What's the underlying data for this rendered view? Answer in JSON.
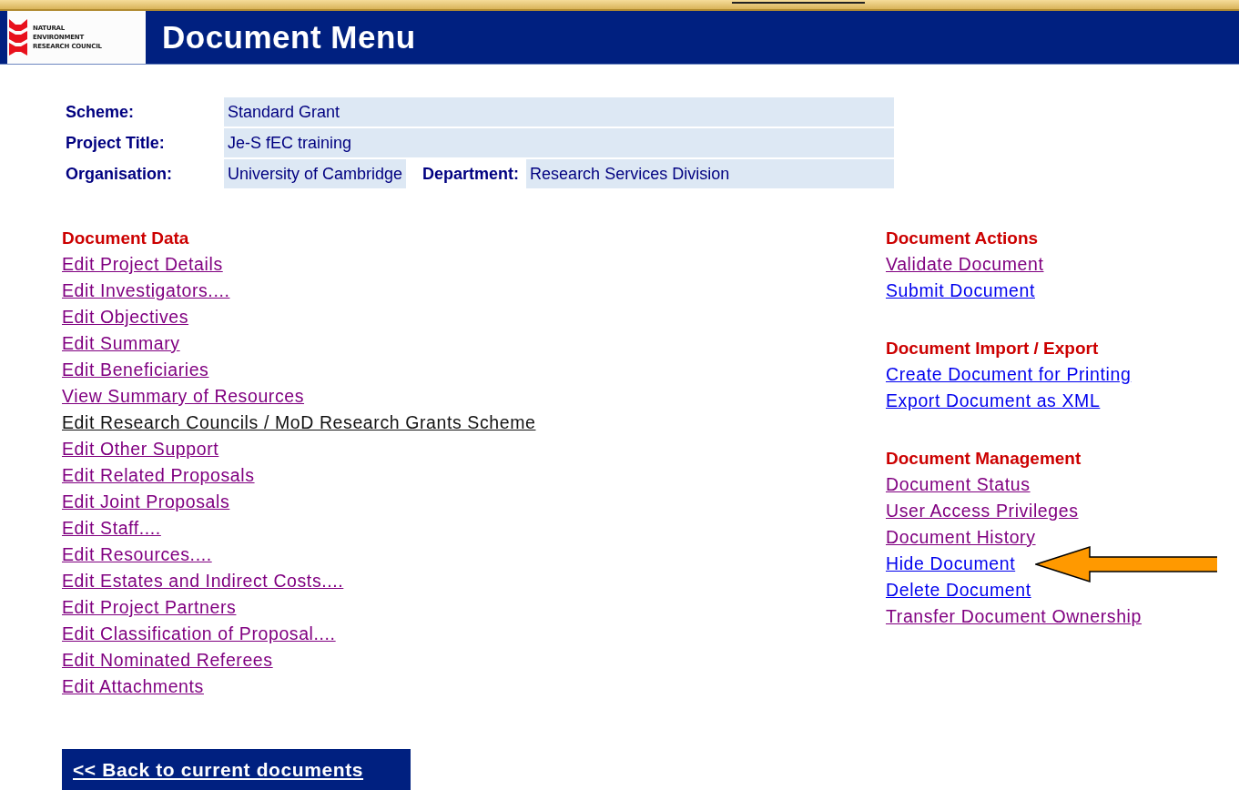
{
  "header": {
    "logo_lines": [
      "NATURAL",
      "ENVIRONMENT",
      "RESEARCH COUNCIL"
    ],
    "title": "Document Menu"
  },
  "info": [
    {
      "label": "Scheme:",
      "value": "Standard Grant"
    },
    {
      "label": "Project Title:",
      "value": "Je-S fEC training"
    },
    {
      "label": "Organisation:",
      "value": "University of Cambridge",
      "label_2": "Department:",
      "value_2": "Research Services Division"
    }
  ],
  "left_sections": [
    {
      "heading": "Document Data",
      "links": [
        {
          "label": "Edit Project Details",
          "visited": true,
          "hover": false
        },
        {
          "label": "Edit Investigators....",
          "visited": true,
          "hover": false
        },
        {
          "label": "Edit Objectives",
          "visited": true,
          "hover": false
        },
        {
          "label": "Edit Summary",
          "visited": true,
          "hover": false
        },
        {
          "label": "Edit Beneficiaries",
          "visited": true,
          "hover": false
        },
        {
          "label": "View Summary of Resources",
          "visited": true,
          "hover": false
        },
        {
          "label": "Edit Research Councils / MoD Research Grants Scheme",
          "hover": true
        },
        {
          "label": "Edit Other Support",
          "visited": true,
          "hover": false
        },
        {
          "label": "Edit Related Proposals",
          "visited": true,
          "hover": false
        },
        {
          "label": "Edit Joint Proposals",
          "visited": true,
          "hover": false
        },
        {
          "label": "Edit Staff....",
          "visited": true,
          "hover": false
        },
        {
          "label": "Edit Resources....",
          "visited": true,
          "hover": false
        },
        {
          "label": "Edit Estates and Indirect Costs....",
          "visited": true,
          "hover": false
        },
        {
          "label": "Edit Project Partners",
          "visited": true,
          "hover": false
        },
        {
          "label": "Edit Classification of Proposal....",
          "visited": true,
          "hover": false
        },
        {
          "label": "Edit Nominated Referees",
          "visited": true,
          "hover": false
        },
        {
          "label": "Edit Attachments",
          "visited": true,
          "hover": false
        }
      ]
    }
  ],
  "right_sections": [
    {
      "heading": "Document Actions",
      "links": [
        {
          "label": "Validate Document",
          "visited": true,
          "hover": false
        },
        {
          "label": "Submit Document",
          "visited": false,
          "hover": false
        }
      ]
    },
    {
      "heading": "Document Import / Export",
      "links": [
        {
          "label": "Create Document for Printing",
          "visited": false,
          "hover": false
        },
        {
          "label": "Export Document as XML",
          "visited": false,
          "hover": false
        }
      ]
    },
    {
      "heading": "Document Management",
      "links": [
        {
          "label": "Document Status",
          "visited": true,
          "hover": false
        },
        {
          "label": "User Access Privileges",
          "visited": true,
          "hover": false
        },
        {
          "label": "Document History",
          "visited": true,
          "hover": false
        },
        {
          "label": "Hide Document",
          "visited": false,
          "hover": false,
          "pointer": true
        },
        {
          "label": "Delete Document",
          "visited": false,
          "hover": false
        },
        {
          "label": "Transfer Document Ownership",
          "visited": true,
          "hover": false
        }
      ]
    }
  ],
  "back_button": "<< Back to current documents"
}
